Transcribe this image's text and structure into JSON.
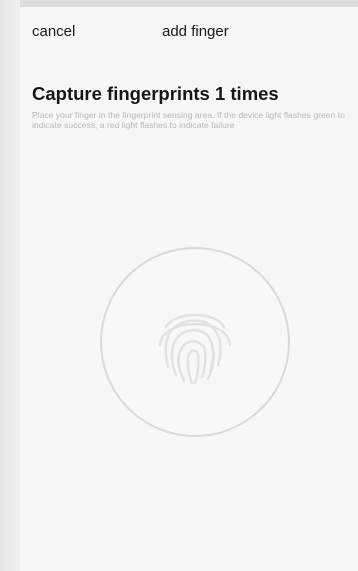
{
  "nav": {
    "cancel_label": "cancel",
    "title": "add finger"
  },
  "content": {
    "heading": "Capture fingerprints 1 times",
    "instructions": "Place your finger in the fingerprint sensing area. If the device light flashes green to indicate success, a red light flashes to indicate failure"
  },
  "sensor": {
    "icon": "fingerprint-icon",
    "ring_color": "#d9d9d9",
    "icon_color": "#e2e2e2"
  }
}
